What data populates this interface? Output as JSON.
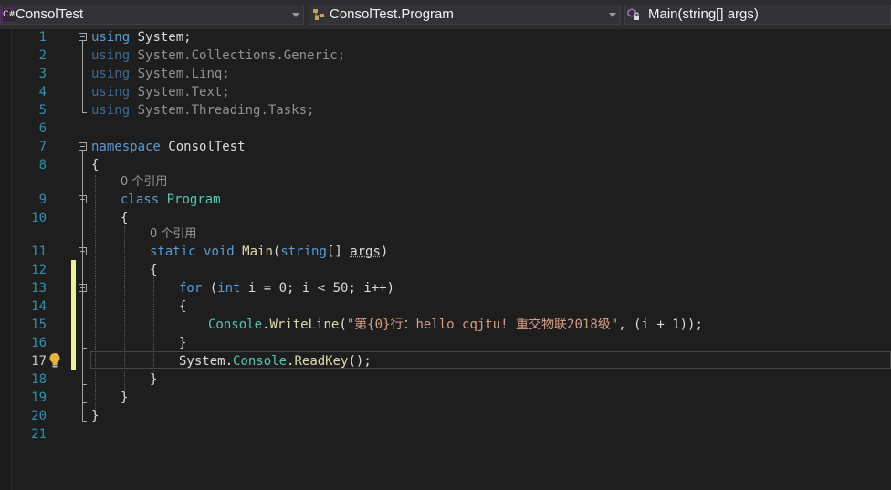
{
  "navbar": {
    "project": "ConsolTest",
    "project_icon": "C#",
    "type": "ConsolTest.Program",
    "member": "Main(string[] args)"
  },
  "line_numbers": [
    "1",
    "2",
    "3",
    "4",
    "5",
    "6",
    "7",
    "8",
    "9",
    "10",
    "11",
    "12",
    "13",
    "14",
    "15",
    "16",
    "17",
    "18",
    "19",
    "20",
    "21"
  ],
  "current_line": "17",
  "code": {
    "using_kw": "using",
    "system": "System;",
    "collections": "System.Collections.Generic;",
    "linq": "System.Linq;",
    "text": "System.Text;",
    "threading": "System.Threading.Tasks;",
    "namespace_kw": "namespace",
    "namespace_name": "ConsolTest",
    "open_brace": "{",
    "close_brace": "}",
    "ref_count": "0 个引用",
    "class_kw": "class",
    "class_name": "Program",
    "static_kw": "static",
    "void_kw": "void",
    "main_name": "Main",
    "params_open": "(",
    "string_kw": "string",
    "params_brackets": "[] ",
    "args_name": "args",
    "params_close": ")",
    "for_kw": "for",
    "for_open": " (",
    "int_kw": "int",
    "for_rest": " i = 0; i < 50; i++)",
    "console": "Console",
    "dot": ".",
    "writeline": "WriteLine",
    "paren_open": "(",
    "string_literal": "\"第{0}行：hello cqjtu! 重交物联2018级\"",
    "writeline_rest": ", (i + 1));",
    "system_prefix": "System.",
    "readkey": "ReadKey",
    "readkey_rest": "();"
  },
  "colors": {
    "keyword": "#569cd6",
    "type": "#4ec9b0",
    "string": "#d69d85",
    "method": "#dcdcaa",
    "line_number": "#2b91af",
    "change_marker": "#efef91"
  }
}
